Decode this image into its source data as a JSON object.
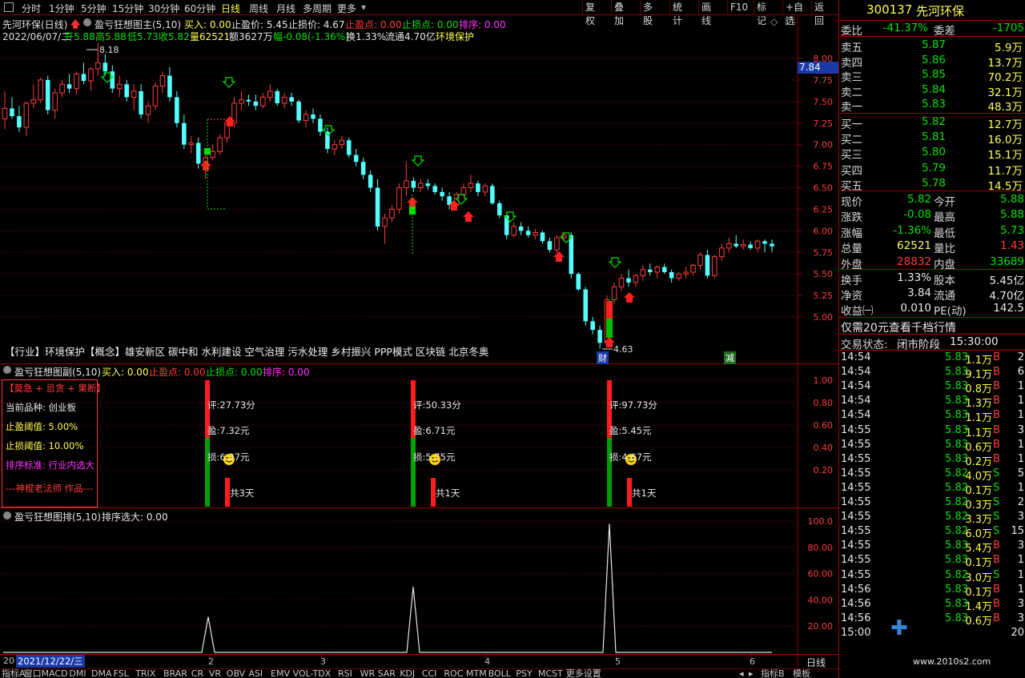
{
  "toolbar": {
    "left": [
      "分时",
      "1分钟",
      "5分钟",
      "15分钟",
      "30分钟",
      "60分钟",
      "日线",
      "周线",
      "月线",
      "多周期",
      "更多"
    ],
    "active": "日线",
    "right": [
      "复权",
      "叠加",
      "多股",
      "统计",
      "画线",
      "F10",
      "标记",
      "+自选",
      "返回"
    ]
  },
  "chart_header": {
    "stock_period": "先河环保(日线)",
    "indicator": "盈亏狂想图主(5,10)",
    "buy": "买入: 0.00",
    "tp": "止盈价: 5.45",
    "sl": "止损价: 4.67",
    "tp_pt": "止盈点: 0.00",
    "sl_pt": "止损点: 0.00",
    "rank": "排序: 0.00",
    "date": "2022/06/07/二",
    "open": "开5.88",
    "high": "高5.88",
    "low": "低5.73",
    "close": "收5.82",
    "vol": "量62521",
    "amount": "额3627万",
    "change": "幅-0.08(-1.36%)",
    "turnover": "换1.33%",
    "float_cap": "流通4.70亿",
    "sector": "环境保护"
  },
  "price_axis": [
    "8.00",
    "7.75",
    "7.50",
    "7.25",
    "7.00",
    "6.75",
    "6.50",
    "6.25",
    "6.00",
    "5.75",
    "5.50",
    "5.25",
    "5.00"
  ],
  "price_tag": "7.84",
  "hi_label": "8.18",
  "lo_label": "4.63",
  "concepts": "【行业】环境保护【概念】雄安新区 碳中和 水利建设 空气治理 污水处理 乡村振兴 PPP模式 区块链 北京冬奥",
  "markers": {
    "cai": "财",
    "jian": "减"
  },
  "sub1": {
    "title": "盈亏狂想图副(5,10)",
    "buy": "买入: 0.00",
    "tp": "止盈点: 0.00",
    "sl": "止损点: 0.00",
    "rank": "排序: 0.00",
    "axis": [
      "1.00",
      "0.80",
      "0.60",
      "0.40",
      "0.20"
    ],
    "info": {
      "header": "【莫急 + 忌贪 + 果断】",
      "product": "当前品种: 创业板",
      "tp_th": "止盈阈值: 5.00%",
      "sl_th": "止损阈值: 10.00%",
      "sort": "排序标准: 行业内选大",
      "author": "---神棍老法师 作品---"
    },
    "signals": [
      {
        "score": "评:27.73分",
        "tp": "盈:7.32元",
        "sl": "损:6.27元",
        "days": "共3天"
      },
      {
        "score": "评:50.33分",
        "tp": "盈:6.71元",
        "sl": "损:5.75元",
        "days": "共1天"
      },
      {
        "score": "评:97.73分",
        "tp": "盈:5.45元",
        "sl": "损:4.67元",
        "days": "共1天"
      }
    ]
  },
  "sub2": {
    "title": "盈亏狂想图排(5,10)",
    "value": "排序选大: 0.00",
    "axis": [
      "100.0",
      "80.00",
      "60.00",
      "40.00",
      "20.00"
    ]
  },
  "xaxis": {
    "date": "2021/12/22/三",
    "year_stub": "20",
    "months": [
      "2",
      "3",
      "4",
      "5",
      "6"
    ],
    "period": "日线"
  },
  "indicator_tabs": [
    "指标A",
    "窗口",
    "MACD",
    "DMI",
    "DMA",
    "FSL",
    "TRIX",
    "BRAR",
    "CR",
    "VR",
    "OBV",
    "ASI",
    "EMV",
    "VOL-TDX",
    "RSI",
    "WR",
    "SAR",
    "KDJ",
    "CCI",
    "ROC",
    "MTM",
    "BOLL",
    "PSY",
    "MCST",
    "更多",
    "设置"
  ],
  "indicator_tabs_right": [
    "指标B",
    "模板"
  ],
  "quote": {
    "code": "300137",
    "name": "先河环保",
    "weibi_label": "委比",
    "weibi": "-41.37%",
    "weicha_label": "委差",
    "weicha": "-1705",
    "asks": [
      {
        "label": "卖五",
        "price": "5.87",
        "vol": "5.9万"
      },
      {
        "label": "卖四",
        "price": "5.86",
        "vol": "13.7万"
      },
      {
        "label": "卖三",
        "price": "5.85",
        "vol": "70.2万"
      },
      {
        "label": "卖二",
        "price": "5.84",
        "vol": "32.1万"
      },
      {
        "label": "卖一",
        "price": "5.83",
        "vol": "48.3万"
      }
    ],
    "bids": [
      {
        "label": "买一",
        "price": "5.82",
        "vol": "12.7万"
      },
      {
        "label": "买二",
        "price": "5.81",
        "vol": "16.0万"
      },
      {
        "label": "买三",
        "price": "5.80",
        "vol": "15.1万"
      },
      {
        "label": "买四",
        "price": "5.79",
        "vol": "11.7万"
      },
      {
        "label": "买五",
        "price": "5.78",
        "vol": "14.5万"
      }
    ],
    "stats": [
      {
        "l1": "现价",
        "v1": "5.82",
        "c1": "grn",
        "l2": "今开",
        "v2": "5.88",
        "c2": "grn"
      },
      {
        "l1": "涨跌",
        "v1": "-0.08",
        "c1": "grn",
        "l2": "最高",
        "v2": "5.88",
        "c2": "grn"
      },
      {
        "l1": "涨幅",
        "v1": "-1.36%",
        "c1": "grn",
        "l2": "最低",
        "v2": "5.73",
        "c2": "grn"
      },
      {
        "l1": "总量",
        "v1": "62521",
        "c1": "yel",
        "l2": "量比",
        "v2": "1.43",
        "c2": "red"
      },
      {
        "l1": "外盘",
        "v1": "28832",
        "c1": "red",
        "l2": "内盘",
        "v2": "33689",
        "c2": "grn"
      }
    ],
    "stats2": [
      {
        "l1": "换手",
        "v1": "1.33%",
        "c1": "wht",
        "l2": "股本",
        "v2": "5.45亿",
        "c2": "wht"
      },
      {
        "l1": "净资",
        "v1": "3.84",
        "c1": "wht",
        "l2": "流通",
        "v2": "4.70亿",
        "c2": "wht"
      },
      {
        "l1": "收益㈠",
        "v1": "0.010",
        "c1": "wht",
        "l2": "PE(动)",
        "v2": "142.5",
        "c2": "wht"
      }
    ],
    "promo": "仅需20元查看千档行情",
    "status_label": "交易状态:",
    "status": "闭市阶段",
    "status_time": "15:30:00",
    "ticks": [
      {
        "t": "14:54",
        "p": "5.83",
        "v": "1.1万",
        "s": "B",
        "n": "2"
      },
      {
        "t": "14:54",
        "p": "5.83",
        "v": "9.1万",
        "s": "B",
        "n": "6"
      },
      {
        "t": "14:54",
        "p": "5.83",
        "v": "0.8万",
        "s": "B",
        "n": "1"
      },
      {
        "t": "14:54",
        "p": "5.83",
        "v": "1.3万",
        "s": "B",
        "n": "1"
      },
      {
        "t": "14:54",
        "p": "5.83",
        "v": "1.1万",
        "s": "B",
        "n": "1"
      },
      {
        "t": "14:55",
        "p": "5.83",
        "v": "1.1万",
        "s": "B",
        "n": "3"
      },
      {
        "t": "14:55",
        "p": "5.83",
        "v": "0.6万",
        "s": "B",
        "n": "1"
      },
      {
        "t": "14:55",
        "p": "5.83",
        "v": "0.2万",
        "s": "B",
        "n": "1"
      },
      {
        "t": "14:55",
        "p": "5.82",
        "v": "4.0万",
        "s": "S",
        "n": "5"
      },
      {
        "t": "14:55",
        "p": "5.82",
        "v": "0.1万",
        "s": "S",
        "n": "1"
      },
      {
        "t": "14:55",
        "p": "5.82",
        "v": "0.3万",
        "s": "S",
        "n": "2"
      },
      {
        "t": "14:55",
        "p": "5.82",
        "v": "3.3万",
        "s": "S",
        "n": "3"
      },
      {
        "t": "14:55",
        "p": "5.82",
        "v": "6.0万",
        "s": "S",
        "n": "15"
      },
      {
        "t": "14:55",
        "p": "5.83",
        "v": "5.4万",
        "s": "B",
        "n": "3"
      },
      {
        "t": "14:55",
        "p": "5.83",
        "v": "0.1万",
        "s": "B",
        "n": "1"
      },
      {
        "t": "14:55",
        "p": "5.82",
        "v": "3.0万",
        "s": "S",
        "n": "1"
      },
      {
        "t": "14:56",
        "p": "5.83",
        "v": "0.1万",
        "s": "B",
        "n": "1"
      },
      {
        "t": "14:56",
        "p": "5.83",
        "v": "1.4万",
        "s": "B",
        "n": "3"
      },
      {
        "t": "14:56",
        "p": "5.83",
        "v": "0.6万",
        "s": "B",
        "n": "3"
      }
    ],
    "last_tick": {
      "t": "15:00",
      "n": "20"
    },
    "watermark": "www.2010s2.com"
  },
  "colors": {
    "up": "#ff3c3c",
    "down": "#54ffff",
    "green": "#00e000",
    "frame": "#9b0000",
    "yellow": "#ffff54",
    "magenta": "#ff33ff"
  }
}
